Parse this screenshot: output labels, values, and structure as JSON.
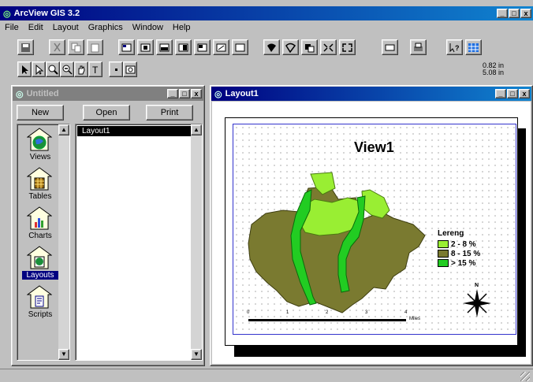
{
  "app": {
    "title": "ArcView GIS 3.2",
    "menus": [
      "File",
      "Edit",
      "Layout",
      "Graphics",
      "Window",
      "Help"
    ],
    "coords": [
      "0.82 in",
      "5.08 in"
    ]
  },
  "project": {
    "title": "Untitled",
    "buttons": {
      "new": "New",
      "open": "Open",
      "print": "Print"
    },
    "doc_types": [
      {
        "label": "Views",
        "icon": "globe-icon"
      },
      {
        "label": "Tables",
        "icon": "table-icon"
      },
      {
        "label": "Charts",
        "icon": "chart-icon"
      },
      {
        "label": "Layouts",
        "icon": "layout-icon",
        "selected": true
      },
      {
        "label": "Scripts",
        "icon": "script-icon"
      }
    ],
    "list_items": [
      "Layout1"
    ]
  },
  "layout": {
    "title": "Layout1",
    "map_title": "View1",
    "legend": {
      "title": "Lereng",
      "items": [
        {
          "label": "2 - 8 %",
          "color": "#99ee33"
        },
        {
          "label": "8 - 15 %",
          "color": "#7a7a30"
        },
        {
          "label": "> 15 %",
          "color": "#22cc22"
        }
      ]
    },
    "scalebar": {
      "ticks": [
        "0",
        "1",
        "2",
        "3",
        "4"
      ],
      "unit": "Miles"
    },
    "north_label": "N"
  },
  "colors": {
    "active_title": "#000080",
    "inactive_title": "#808080",
    "desktop": "#c0c0c0"
  }
}
